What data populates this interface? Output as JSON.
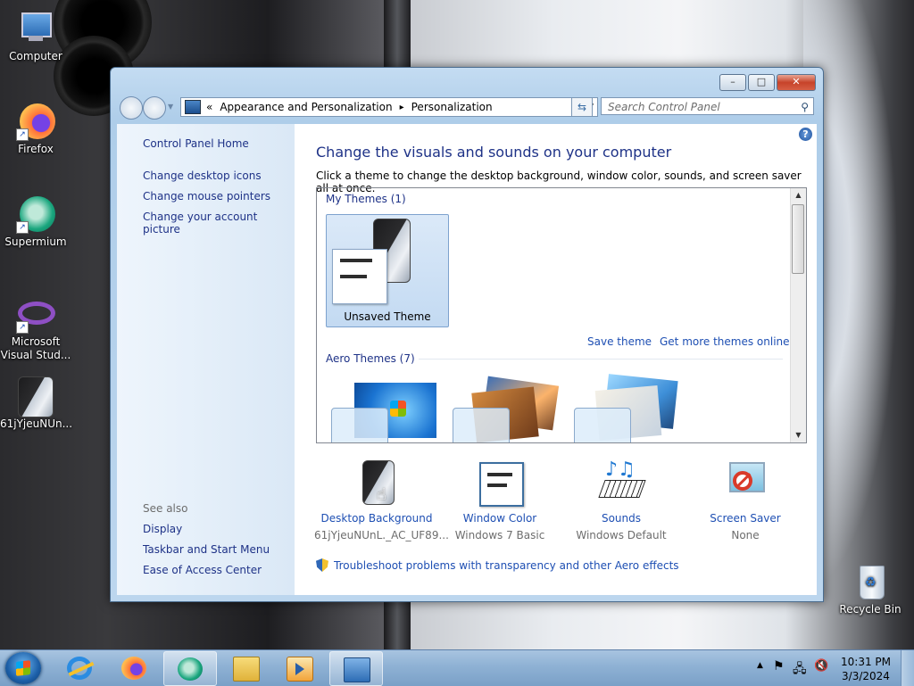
{
  "desktop": {
    "icons": [
      {
        "label": "Computer",
        "icon": "computer-icon"
      },
      {
        "label": "Firefox",
        "icon": "firefox-icon"
      },
      {
        "label": "Supermium",
        "icon": "supermium-icon"
      },
      {
        "label": "Microsoft Visual Stud...",
        "icon": "visual-studio-icon"
      },
      {
        "label": "61jYjeuNUn...",
        "icon": "image-file-icon"
      },
      {
        "label": "Recycle Bin",
        "icon": "recycle-bin-icon"
      }
    ]
  },
  "window": {
    "caption_buttons": {
      "minimize": "–",
      "maximize": "□",
      "close": "✕"
    },
    "address": {
      "chevrons": "«",
      "crumb1": "Appearance and Personalization",
      "separator": "▸",
      "crumb2": "Personalization"
    },
    "search": {
      "placeholder": "Search Control Panel"
    },
    "left_pane": {
      "home": "Control Panel Home",
      "links": [
        "Change desktop icons",
        "Change mouse pointers",
        "Change your account picture"
      ],
      "see_also_title": "See also",
      "see_also": [
        "Display",
        "Taskbar and Start Menu",
        "Ease of Access Center"
      ]
    },
    "main": {
      "title": "Change the visuals and sounds on your computer",
      "subtitle": "Click a theme to change the desktop background, window color, sounds, and screen saver all at once.",
      "my_themes_header": "My Themes (1)",
      "unsaved_theme": "Unsaved Theme",
      "save_theme": "Save theme",
      "get_more": "Get more themes online",
      "aero_header": "Aero Themes (7)"
    },
    "tiles": [
      {
        "title": "Desktop Background",
        "value": "61jYjeuNUnL._AC_UF89..."
      },
      {
        "title": "Window Color",
        "value": "Windows 7 Basic"
      },
      {
        "title": "Sounds",
        "value": "Windows Default"
      },
      {
        "title": "Screen Saver",
        "value": "None"
      }
    ],
    "troubleshoot": "Troubleshoot problems with transparency and other Aero effects"
  },
  "taskbar": {
    "buttons": [
      "internet-explorer-icon",
      "firefox-icon",
      "supermium-icon",
      "explorer-icon",
      "media-player-icon",
      "control-panel-icon"
    ],
    "clock": {
      "time": "10:31 PM",
      "date": "3/3/2024"
    }
  },
  "colors": {
    "link": "#1e4fb3",
    "heading": "#1e3287",
    "taskbar": "#8eb1d4"
  }
}
